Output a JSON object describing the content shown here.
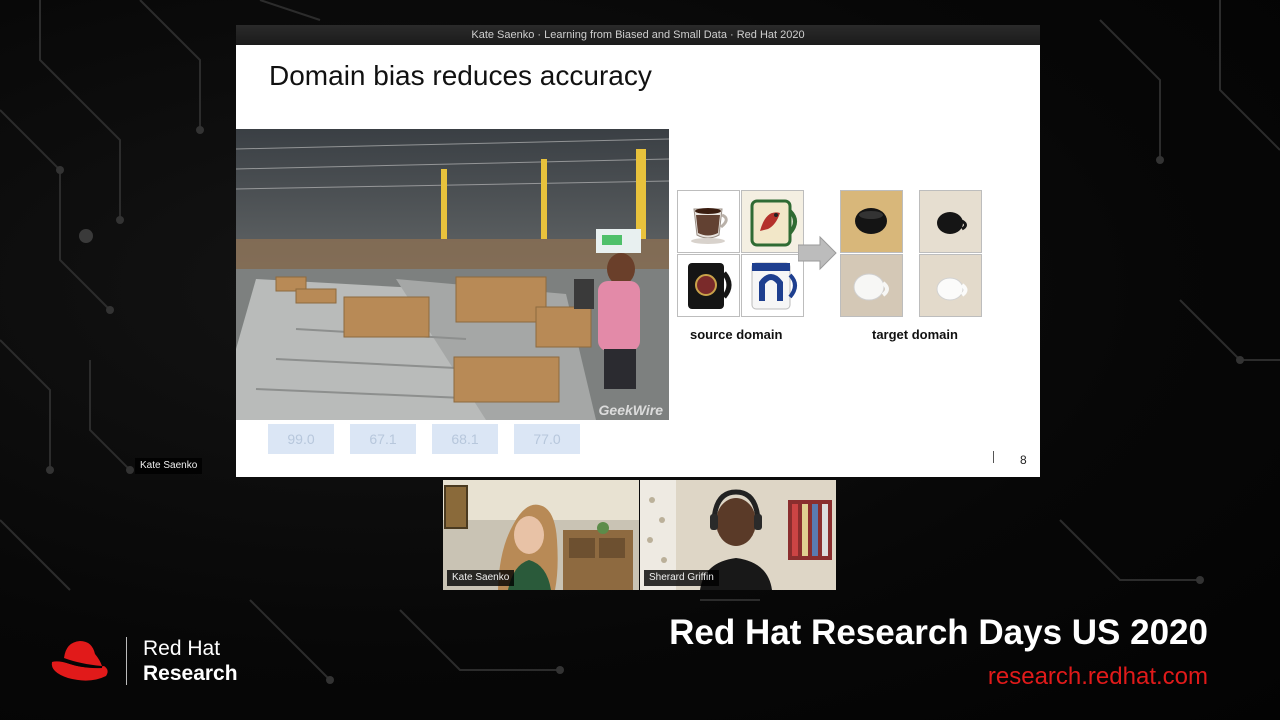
{
  "slide": {
    "header": "Kate Saenko · Learning from Biased and Small Data · Red Hat 2020",
    "title": "Domain bias reduces accuracy",
    "photo_watermark": "GeekWire",
    "accuracy_values": [
      "99.0",
      "67.1",
      "68.1",
      "77.0"
    ],
    "source_caption": "source domain",
    "target_caption": "target domain",
    "page_number": "8"
  },
  "presenter_label": "Kate Saenko",
  "participants": [
    {
      "name": "Kate Saenko"
    },
    {
      "name": "Sherard Griffin"
    }
  ],
  "branding": {
    "logo_line1": "Red Hat",
    "logo_line2": "Research",
    "event_title": "Red Hat Research Days US 2020",
    "event_url": "research.redhat.com",
    "accent_color": "#e11a1a"
  }
}
